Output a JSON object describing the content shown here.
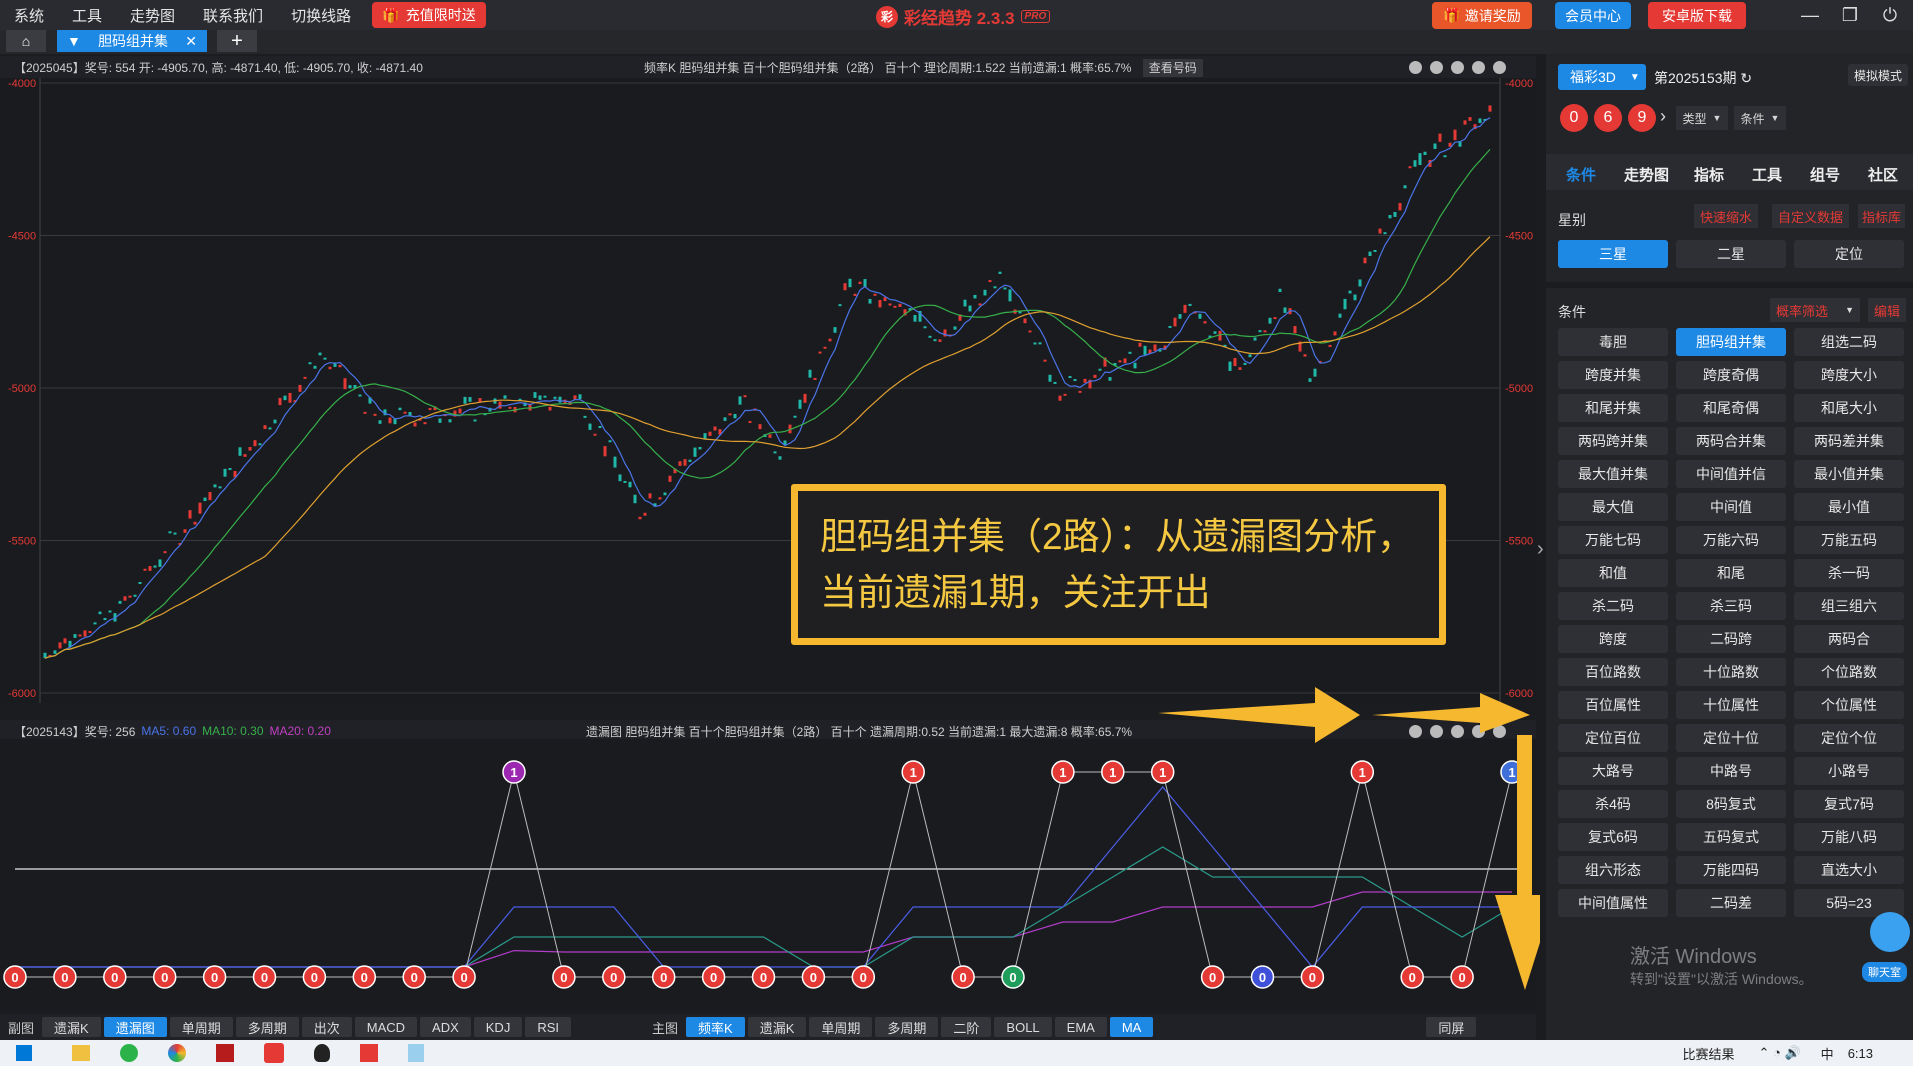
{
  "menu": [
    "系统",
    "工具",
    "走势图",
    "联系我们",
    "切换线路"
  ],
  "promo": "充值限时送",
  "app": {
    "name": "彩经趋势 2.3.3",
    "logo": "彩",
    "badge": "PRO"
  },
  "top_buttons": {
    "invite": "邀请奖励",
    "member": "会员中心",
    "android": "安卓版下载"
  },
  "tab": {
    "label": "胆码组并集",
    "add": "+"
  },
  "main_info": {
    "left": "【2025045】奖号: 554  开: -4905.70, 高: -4871.40, 低: -4905.70, 收: -4871.40",
    "mid": "频率K  胆码组并集  百十个胆码组并集（2路）   百十个  理论周期:1.522  当前遗漏:1  概率:65.7%",
    "btn": "查看号码"
  },
  "main_axis": [
    "-4000",
    "-4500",
    "-5000",
    "-5500",
    "-6000"
  ],
  "sub_info": {
    "left": "【2025143】奖号: 256",
    "ma5": "MA5: 0.60",
    "ma10": "MA10: 0.30",
    "ma20": "MA20: 0.20",
    "mid": "遗漏图  胆码组并集  百十个胆码组并集（2路）   百十个  遗漏周期:0.52  当前遗漏:1  最大遗漏:8  概率:65.7%"
  },
  "callout": {
    "line1": "胆码组并集（2路）：从遗漏图分析，",
    "line2": "当前遗漏1期，关注开出"
  },
  "sub_points": [
    0,
    0,
    0,
    0,
    0,
    0,
    0,
    0,
    0,
    0,
    1,
    0,
    0,
    0,
    0,
    0,
    0,
    0,
    1,
    0,
    0,
    1,
    1,
    1,
    0,
    0,
    0,
    1,
    0,
    0,
    1
  ],
  "sub_point_colors": [
    "#e53935",
    "#e53935",
    "#e53935",
    "#e53935",
    "#e53935",
    "#e53935",
    "#e53935",
    "#e53935",
    "#e53935",
    "#e53935",
    "#9c27b0",
    "#e53935",
    "#e53935",
    "#e53935",
    "#e53935",
    "#e53935",
    "#e53935",
    "#e53935",
    "#e53935",
    "#e53935",
    "#1e9e5a",
    "#e53935",
    "#e53935",
    "#e53935",
    "#e53935",
    "#3f51d8",
    "#e53935",
    "#e53935",
    "#e53935",
    "#e53935",
    "#3f6fd8"
  ],
  "bottom": {
    "left_label": "副图",
    "left": [
      "遗漏K",
      "遗漏图",
      "单周期",
      "多周期",
      "出次",
      "MACD",
      "ADX",
      "KDJ",
      "RSI"
    ],
    "left_on": 1,
    "right_label": "主图",
    "right": [
      "频率K",
      "遗漏K",
      "单周期",
      "多周期",
      "二阶",
      "BOLL",
      "EMA",
      "MA"
    ],
    "right_on": [
      0,
      7
    ],
    "sync": "同屏"
  },
  "right": {
    "lottery": "福彩3D",
    "period": "第2025153期",
    "mode": "模拟模式",
    "balls": [
      "0",
      "6",
      "9"
    ],
    "type": "类型",
    "cond": "条件",
    "tabs": [
      "条件",
      "走势图",
      "指标",
      "工具",
      "组号",
      "社区"
    ],
    "star_label": "星别",
    "links": [
      "快速缩水",
      "自定义数据",
      "指标库"
    ],
    "stars": [
      "三星",
      "二星",
      "定位"
    ],
    "cond_label": "条件",
    "prob": "概率筛选",
    "edit": "编辑",
    "grid": [
      "毒胆",
      "胆码组并集",
      "组选二码",
      "跨度并集",
      "跨度奇偶",
      "跨度大小",
      "和尾并集",
      "和尾奇偶",
      "和尾大小",
      "两码跨并集",
      "两码合并集",
      "两码差并集",
      "最大值并集",
      "中间值并信",
      "最小值并集",
      "最大值",
      "中间值",
      "最小值",
      "万能七码",
      "万能六码",
      "万能五码",
      "和值",
      "和尾",
      "杀一码",
      "杀二码",
      "杀三码",
      "组三组六",
      "跨度",
      "二码跨",
      "两码合",
      "百位路数",
      "十位路数",
      "个位路数",
      "百位属性",
      "十位属性",
      "个位属性",
      "定位百位",
      "定位十位",
      "定位个位",
      "大路号",
      "中路号",
      "小路号",
      "杀4码",
      "8码复式",
      "复式7码",
      "复式6码",
      "五码复式",
      "万能八码",
      "组六形态",
      "万能四码",
      "直选大小",
      "中间值属性",
      "二码差",
      "5码=23"
    ]
  },
  "watermark": {
    "line1": "激活 Windows",
    "line2": "转到\"设置\"以激活 Windows。"
  },
  "chat": "聊天室",
  "taskbar": {
    "item": "比赛结果",
    "clock": "6:13",
    "ime": "中"
  }
}
